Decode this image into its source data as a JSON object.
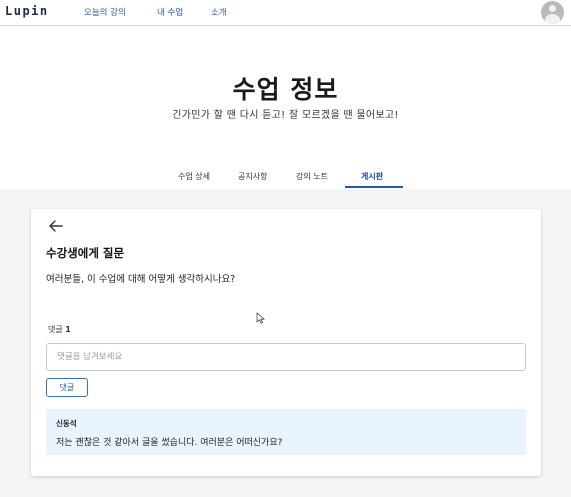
{
  "nav": {
    "logo": "Lupin",
    "links": [
      "오늘의 강의",
      "내 수업",
      "소개"
    ]
  },
  "hero": {
    "title": "수업 정보",
    "subtitle": "긴가민가 할 땐 다시 듣고! 잘 모르겠을 땐 물어보고!"
  },
  "tabs": {
    "items": [
      "수업 상세",
      "공지사항",
      "강의 노트",
      "게시판"
    ],
    "active": "게시판"
  },
  "post": {
    "title": "수강생에게 질문",
    "body": "여러분들, 이 수업에 대해 어떻게 생각하시나요?"
  },
  "comments": {
    "count_label": "댓글",
    "count": "1",
    "input_placeholder": "댓글을 남겨보세요",
    "submit_label": "댓글",
    "items": [
      {
        "author": "신동석",
        "text": "저는 괜찮은 것 같아서 글을 썼습니다. 여러분은 어떠신가요?"
      }
    ]
  },
  "colors": {
    "accent": "#1e5aa8",
    "comment_bg": "#e8f3fd",
    "page_bg": "#f3f4f5"
  }
}
